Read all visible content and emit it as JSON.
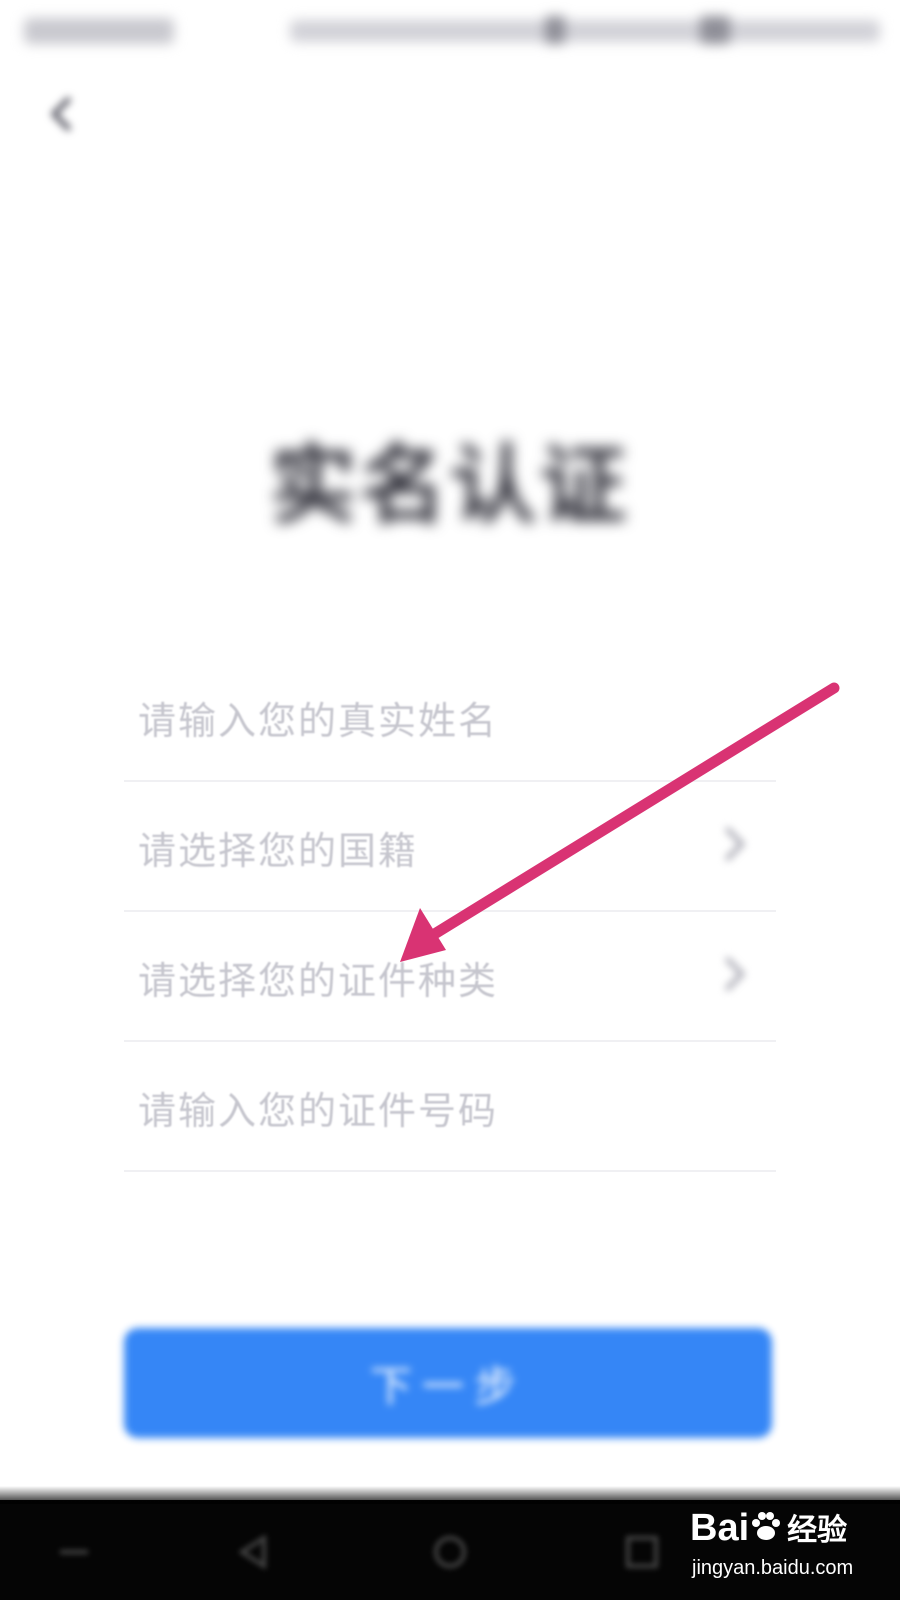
{
  "header": {
    "back_icon": "chevron-left-icon"
  },
  "page": {
    "title": "实名认证"
  },
  "form": {
    "fields": [
      {
        "placeholder": "请输入您的真实姓名",
        "has_chevron": false
      },
      {
        "placeholder": "请选择您的国籍",
        "has_chevron": true
      },
      {
        "placeholder": "请选择您的证件种类",
        "has_chevron": true
      },
      {
        "placeholder": "请输入您的证件号码",
        "has_chevron": false
      }
    ]
  },
  "actions": {
    "next_label": "下一步"
  },
  "watermark": {
    "brand": "Bai",
    "brand_cn": "经验",
    "url": "jingyan.baidu.com"
  },
  "colors": {
    "primary_button": "#2f83f6",
    "placeholder_text": "#c6c6ce",
    "annotation_arrow": "#d93373",
    "nav_bar": "#050505"
  }
}
